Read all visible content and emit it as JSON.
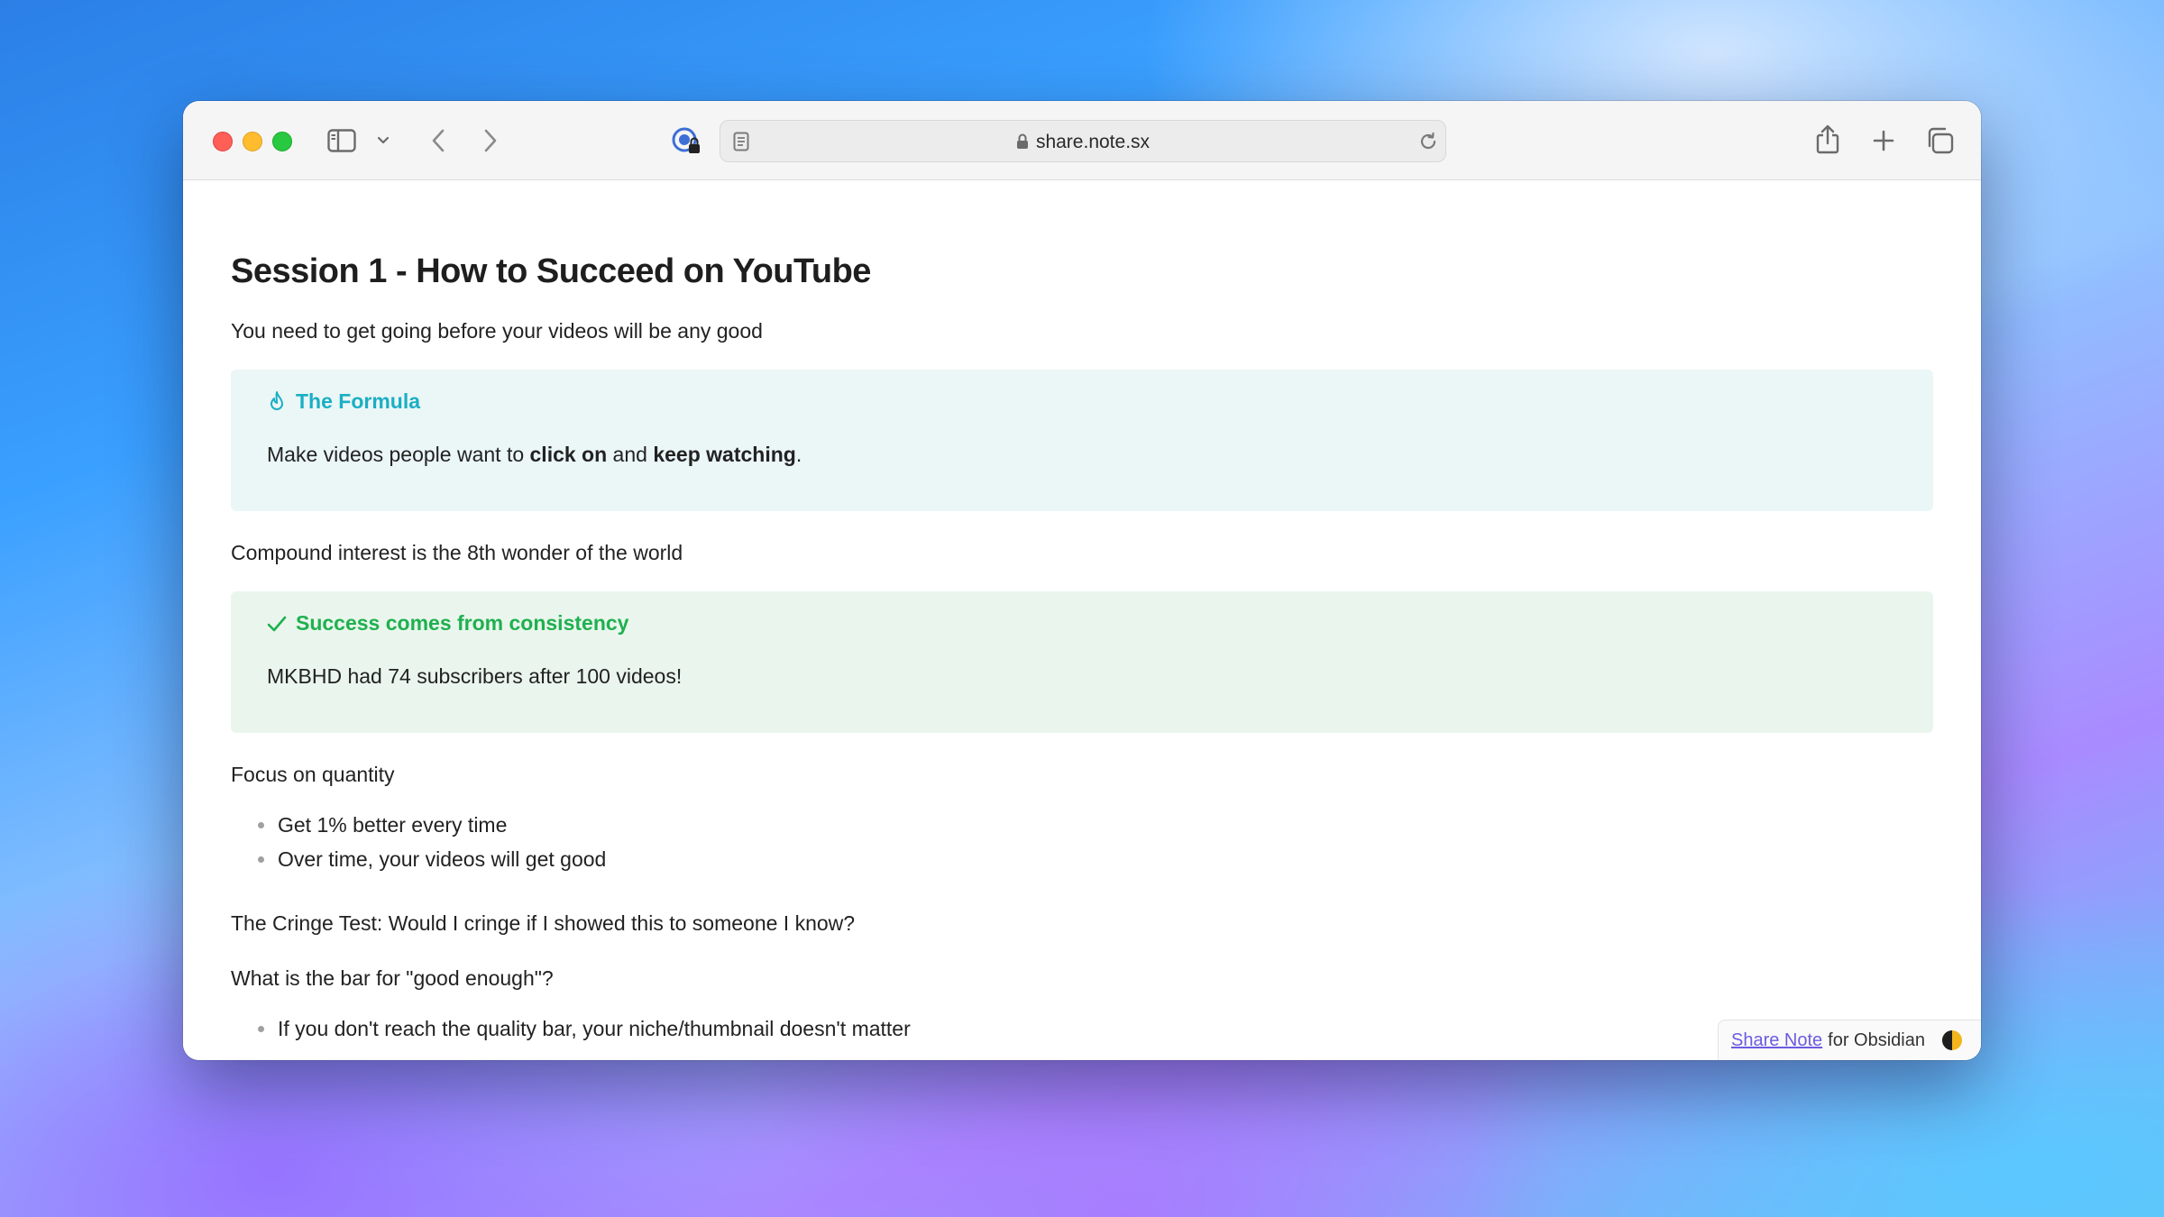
{
  "browser": {
    "url": "share.note.sx"
  },
  "note": {
    "title": "Session 1 - How to Succeed on YouTube",
    "intro": "You need to get going before your videos will be any good",
    "callout_formula": {
      "title": "The Formula",
      "body_prefix": "Make videos people want to ",
      "body_bold_1": "click on",
      "body_middle": " and ",
      "body_bold_2": "keep watching",
      "body_suffix": ".",
      "accent_color": "#1aafc4",
      "background_color": "#ebf6f6",
      "icon": "flame-icon"
    },
    "compound": "Compound interest is the 8th wonder of the world",
    "callout_success": {
      "title": "Success comes from consistency",
      "body": "MKBHD had 74 subscribers after 100 videos!",
      "accent_color": "#1fb04f",
      "background_color": "#eaf6ed",
      "icon": "check-icon"
    },
    "focus": "Focus on quantity",
    "focus_bullets": [
      "Get 1% better every time",
      "Over time, your videos will get good"
    ],
    "cringe": "The Cringe Test: Would I cringe if I showed this to someone I know?",
    "bar_question": "What is the bar for \"good enough\"?",
    "bar_bullets": [
      "If you don't reach the quality bar, your niche/thumbnail doesn't matter"
    ]
  },
  "share_badge": {
    "link_text": "Share Note",
    "suffix": " for Obsidian"
  }
}
